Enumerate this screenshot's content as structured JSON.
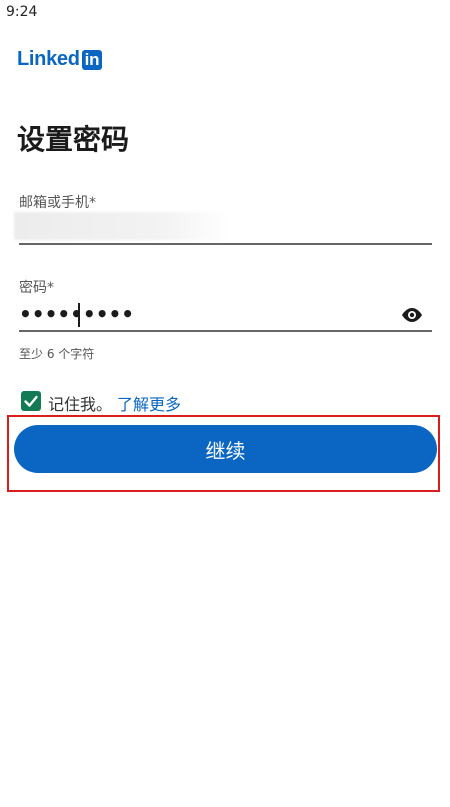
{
  "status_bar": {
    "time": "9:24"
  },
  "logo": {
    "text_left": "Linked",
    "text_box": "in",
    "brand_color": "#0a66c2"
  },
  "page": {
    "title": "设置密码"
  },
  "email_field": {
    "label": "邮箱或手机*"
  },
  "password_field": {
    "label": "密码*",
    "masked_value": "•••••••••",
    "helper": "至少 6 个字符",
    "visibility_icon": "eye-icon"
  },
  "remember": {
    "checked": true,
    "label": "记住我。",
    "learn_more": "了解更多",
    "checkbox_color": "#127a54"
  },
  "continue_button": {
    "label": "继续",
    "color": "#0a66c2"
  },
  "annotation": {
    "highlight_color": "#d91d1d"
  }
}
